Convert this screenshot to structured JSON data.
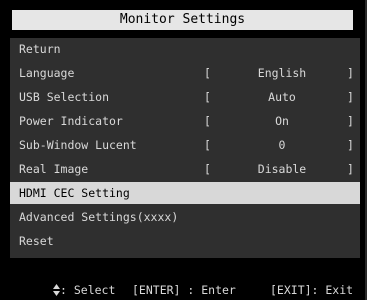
{
  "osd": {
    "title": "Monitor Settings",
    "menu_items": [
      {
        "label": "Return"
      },
      {
        "label": "Language",
        "bracket_open": "[",
        "value": "English",
        "bracket_close": "]"
      },
      {
        "label": "USB Selection",
        "bracket_open": "[",
        "value": "Auto",
        "bracket_close": "]"
      },
      {
        "label": "Power Indicator",
        "bracket_open": "[",
        "value": "On",
        "bracket_close": "]"
      },
      {
        "label": "Sub-Window Lucent",
        "bracket_open": "[",
        "value": "0",
        "bracket_close": "]"
      },
      {
        "label": "Real Image",
        "bracket_open": "[",
        "value": "Disable",
        "bracket_close": "]"
      },
      {
        "label": "HDMI CEC Setting",
        "selected": true
      },
      {
        "label": "Advanced Settings(xxxx)"
      },
      {
        "label": "Reset"
      }
    ],
    "footer": {
      "select_icon": "up-down-arrow-icon",
      "select_hint": ": Select",
      "enter_hint": "[ENTER] : Enter",
      "exit_hint": "[EXIT]: Exit"
    },
    "colors": {
      "background": "#000000",
      "menu_panel": "#2f2f2f",
      "title_bar": "#e6e6e6",
      "highlight": "#d8d8d8",
      "text": "#d9d9d9"
    }
  }
}
